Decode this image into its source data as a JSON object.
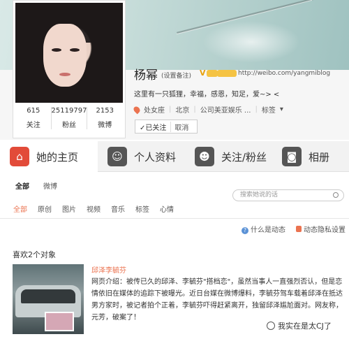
{
  "profile": {
    "name": "杨幂",
    "remark": "(设置备注)",
    "v_badge": "V",
    "url": "http://weibo.com/yangmiblog",
    "bio": "这里有一只狐狸，幸福，感恩，知足，爱~> <",
    "zodiac": "处女座",
    "location": "北京",
    "company": "公司美亚娱乐 ...",
    "tags": "标签",
    "follow_status": "✓已关注",
    "cancel": "取消"
  },
  "stats": [
    {
      "value": "615",
      "label": "关注"
    },
    {
      "value": "25119797",
      "label": "粉丝"
    },
    {
      "value": "2153",
      "label": "微博"
    }
  ],
  "tabs": [
    {
      "label": "她的主页",
      "icon": "home-icon"
    },
    {
      "label": "个人资料",
      "icon": "person-icon"
    },
    {
      "label": "关注/粉丝",
      "icon": "people-icon"
    },
    {
      "label": "相册",
      "icon": "camera-icon"
    }
  ],
  "subnav": {
    "all": "全部",
    "weibo": "微博"
  },
  "search": {
    "placeholder": "搜索她说的话"
  },
  "filters": [
    "全部",
    "原创",
    "图片",
    "视频",
    "音乐",
    "标签",
    "心情"
  ],
  "links": {
    "what": "什么是动态",
    "privacy": "动态隐私设置"
  },
  "likes": {
    "heading": "喜欢2个对象",
    "article_title": "邱泽李毓芬",
    "article_body": "网页介绍：被传已久的邱泽、李毓芬\"搭档恋\"，虽然当事人一直强烈否认，但是恋情依旧在媒体的追踪下被曝光。近日台媒在微博爆料，李毓芬驾车载着邱泽在抵达男方家时，被记者拍个正着，李毓芬吓得赶紧离开，独留邱泽尴尬面对。网友称，元芳，破案了！"
  },
  "watermark": "我实在是太CJ了",
  "colors": {
    "accent": "#eb7350",
    "tab_red": "#e24b39"
  }
}
